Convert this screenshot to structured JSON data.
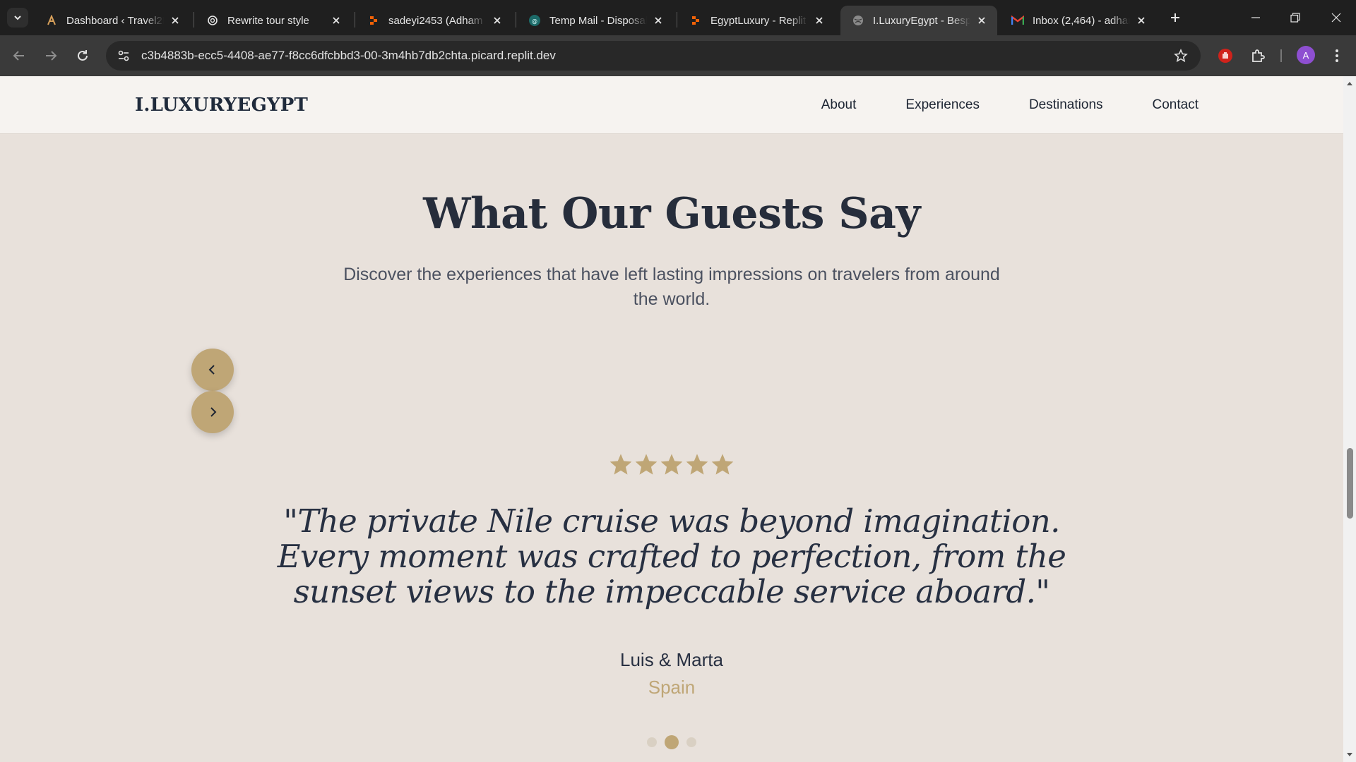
{
  "browser": {
    "tabs": [
      {
        "title": "Dashboard ‹ Travel2E",
        "icon": "travel-logo-icon"
      },
      {
        "title": "Rewrite tour style",
        "icon": "chatgpt-icon"
      },
      {
        "title": "sadeyi2453 (Adham H",
        "icon": "replit-icon"
      },
      {
        "title": "Temp Mail - Disposab",
        "icon": "tempmail-icon"
      },
      {
        "title": "EgyptLuxury - Replit",
        "icon": "replit-icon"
      },
      {
        "title": "I.LuxuryEgypt - Bespo",
        "icon": "globe-icon",
        "active": true
      },
      {
        "title": "Inbox (2,464) - adhar",
        "icon": "gmail-icon"
      }
    ],
    "url": "c3b4883b-ecc5-4408-ae77-f8cc6dfcbbd3-00-3m4hb7db2chta.picard.replit.dev",
    "profile_initial": "A"
  },
  "site": {
    "logo": "I.LUXURYEGYPT",
    "nav": [
      "About",
      "Experiences",
      "Destinations",
      "Contact"
    ]
  },
  "testimonials": {
    "title": "What Our Guests Say",
    "subtitle": "Discover the experiences that have left lasting impressions on travelers from around the world.",
    "rating": 5,
    "quote": "\"The private Nile cruise was beyond imagination. Every moment was crafted to perfection, from the sunset views to the impeccable service aboard.\"",
    "author": "Luis & Marta",
    "country": "Spain",
    "slide_count": 3,
    "active_slide": 1
  },
  "colors": {
    "accent": "#bfa676",
    "heading": "#262d3b",
    "background": "#e8e1db"
  }
}
